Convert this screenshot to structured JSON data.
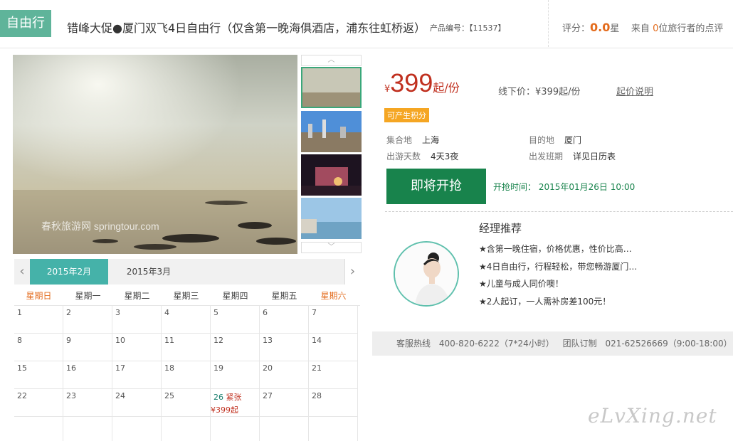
{
  "header": {
    "tag": "自由行",
    "title": "错峰大促●厦门双飞4日自由行（仅含第一晚海俱酒店，浦东往虹桥返）",
    "product_code_label": "产品编号：",
    "product_code": "【11537】",
    "rating_label": "评分：",
    "rating_value": "0.0",
    "rating_unit": "星",
    "review_prefix": "来自",
    "review_count": "0",
    "review_suffix": "位旅行者的点评"
  },
  "gallery": {
    "watermark_text": "春秋旅游网 springtour.com",
    "thumb_up_icon": "chevron-up-icon",
    "thumb_down_icon": "chevron-down-icon"
  },
  "calendar": {
    "tabs": [
      "2015年2月",
      "2015年3月"
    ],
    "weekdays": [
      "星期日",
      "星期一",
      "星期二",
      "星期三",
      "星期四",
      "星期五",
      "星期六"
    ],
    "weeks": [
      [
        "1",
        "2",
        "3",
        "4",
        "5",
        "6",
        "7"
      ],
      [
        "8",
        "9",
        "10",
        "11",
        "12",
        "13",
        "14"
      ],
      [
        "15",
        "16",
        "17",
        "18",
        "19",
        "20",
        "21"
      ],
      [
        "22",
        "23",
        "24",
        "25",
        "26",
        "27",
        "28"
      ],
      [
        "",
        "",
        "",
        "",
        "",
        "",
        ""
      ]
    ],
    "special_status": "紧张",
    "special_price": "¥399起"
  },
  "product": {
    "currency": "¥",
    "price": "399",
    "price_unit": "起/份",
    "offline_price": "线下价：¥399起/份",
    "price_explain": "起价说明",
    "points_badge": "可产生积分",
    "depart_label": "集合地",
    "depart_value": "上海",
    "dest_label": "目的地",
    "dest_value": "厦门",
    "days_label": "出游天数",
    "days_value": "4天3夜",
    "schedule_label": "出发班期",
    "schedule_value": "详见日历表",
    "buy_button": "即将开抢",
    "start_time": "开抢时间：  2015年01月26日 10:00"
  },
  "manager": {
    "title": "经理推荐",
    "items": [
      "★含第一晚住宿，价格优惠，性价比高…",
      "★4日自由行，行程轻松，带您畅游厦门…",
      "★儿童与成人同价噢！",
      "★2人起订，一人需补房差100元！"
    ]
  },
  "hotline": {
    "service_label": "客服热线",
    "service_phone": "400-820-6222（7*24小时）",
    "group_label": "团队订制",
    "group_phone": "021-62526669（9:00-18:00）"
  },
  "site_watermark": "eLvXing.net"
}
